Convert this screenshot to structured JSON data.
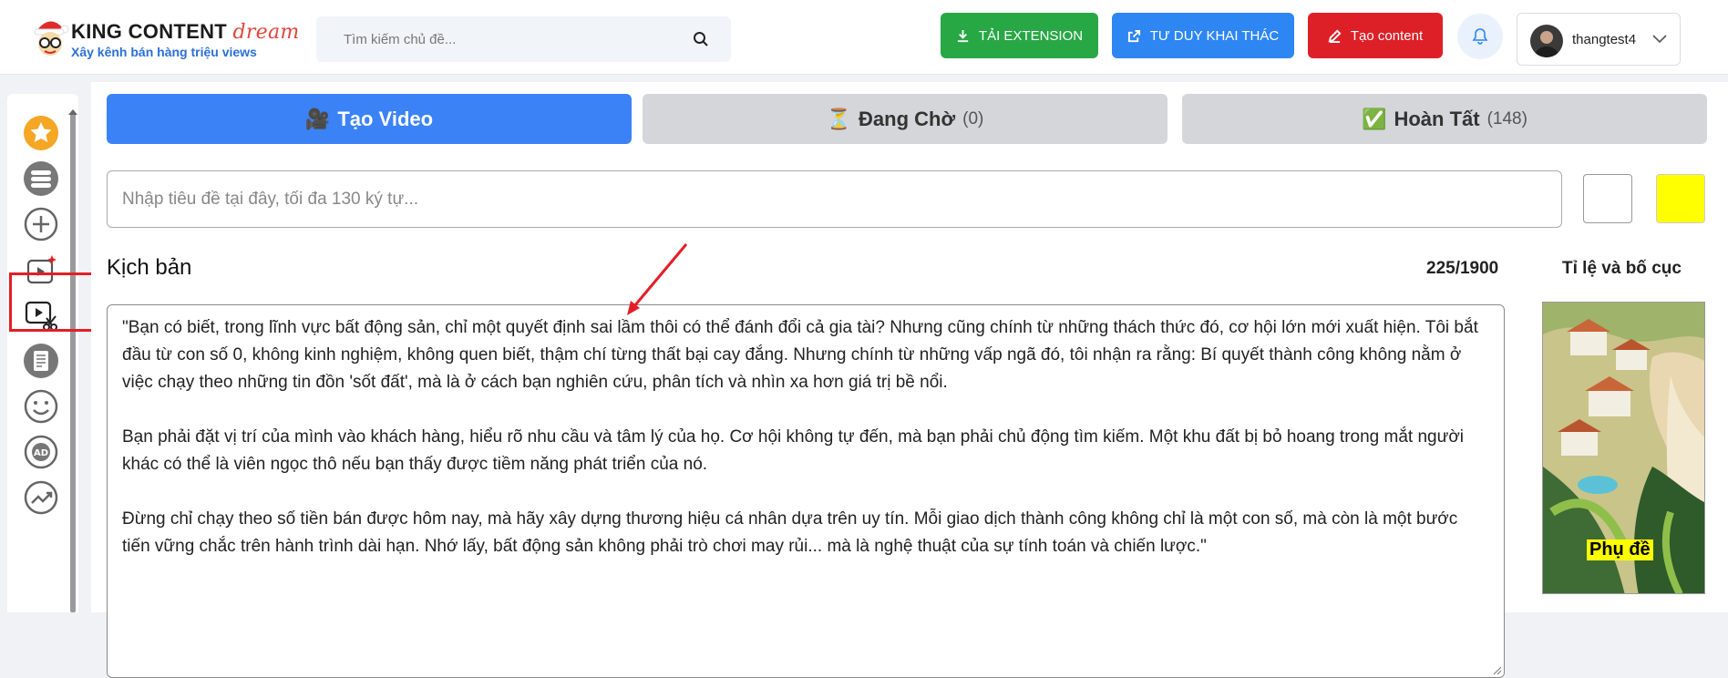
{
  "header": {
    "logo_title": "KING CONTENT",
    "logo_title_suffix": "dream",
    "logo_subtitle": "Xây kênh bán hàng triệu views",
    "search_placeholder": "Tìm kiếm chủ đề...",
    "btn_extension": "TẢI EXTENSION",
    "btn_think": "TƯ DUY KHAI THÁC",
    "btn_create": "Tạo content",
    "username": "thangtest4",
    "colors": {
      "extension": "#28a745",
      "think": "#2d86f2",
      "create": "#dd2027"
    }
  },
  "sidebar": {
    "items": [
      {
        "icon": "star-icon"
      },
      {
        "icon": "list-icon"
      },
      {
        "icon": "plus-circle-icon"
      },
      {
        "icon": "video-spark-icon",
        "highlighted": true
      },
      {
        "icon": "video-cut-icon"
      },
      {
        "icon": "document-icon"
      },
      {
        "icon": "smile-icon"
      },
      {
        "icon": "ad-icon"
      },
      {
        "icon": "trend-icon"
      }
    ]
  },
  "tabs": {
    "create": {
      "label": "Tạo Video"
    },
    "waiting": {
      "label": "Đang Chờ",
      "count": "(0)"
    },
    "done": {
      "label": "Hoàn Tất",
      "count": "(148)"
    }
  },
  "form": {
    "title_placeholder": "Nhập tiêu đề tại đây, tối đa 130 ký tự...",
    "text_color": "#ffffff",
    "highlight_color": "#ffff00",
    "script_label": "Kịch bản",
    "char_count": "225/1900",
    "ratio_label": "Tỉ lệ và bố cục",
    "preview_caption": "Phụ đề",
    "script_paragraphs": [
      "\"Bạn có biết, trong lĩnh vực bất động sản, chỉ một quyết định sai lầm thôi có thể đánh đổi cả gia tài? Nhưng cũng chính từ những thách thức đó, cơ hội lớn mới xuất hiện. Tôi bắt đầu từ con số 0, không kinh nghiệm, không quen biết, thậm chí từng thất bại cay đắng. Nhưng chính từ những vấp ngã đó, tôi nhận ra rằng: Bí quyết thành công không nằm ở việc chạy theo những tin đồn 'sốt đất', mà là ở cách bạn nghiên cứu, phân tích và nhìn xa hơn giá trị bề nổi.",
      "Bạn phải đặt vị trí của mình vào khách hàng, hiểu rõ nhu cầu và tâm lý của họ. Cơ hội không tự đến, mà bạn phải chủ động tìm kiếm. Một khu đất bị bỏ hoang trong mắt người khác có thể là viên ngọc thô nếu bạn thấy được tiềm năng phát triển của nó.",
      "Đừng chỉ chạy theo số tiền bán được hôm nay, mà hãy xây dựng thương hiệu cá nhân dựa trên uy tín. Mỗi giao dịch thành công không chỉ là một con số, mà còn là một bước tiến vững chắc trên hành trình dài hạn. Nhớ lấy, bất động sản không phải trò chơi may rủi... mà là nghệ thuật của sự tính toán và chiến lược.\""
    ]
  }
}
